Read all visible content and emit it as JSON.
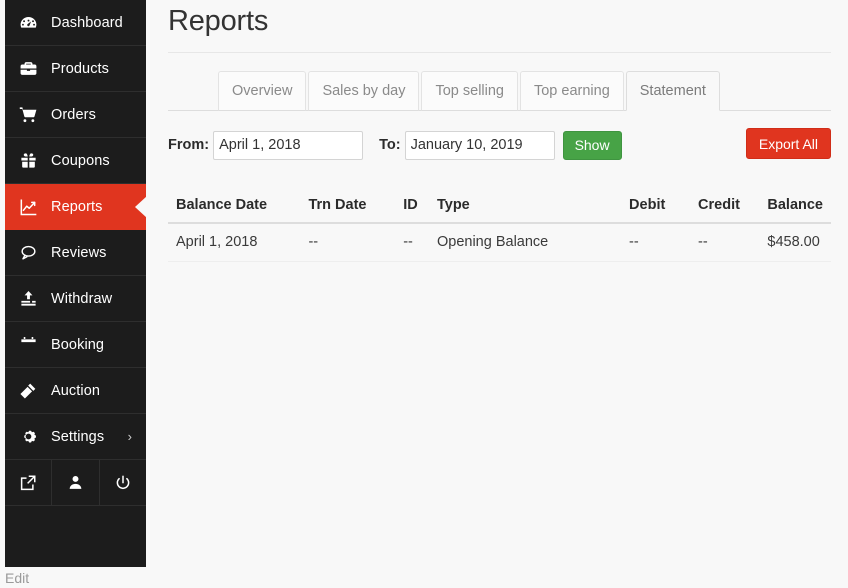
{
  "sidebar": {
    "items": [
      {
        "label": "Dashboard",
        "icon": "dashboard-gauge-icon",
        "active": false
      },
      {
        "label": "Products",
        "icon": "briefcase-icon",
        "active": false
      },
      {
        "label": "Orders",
        "icon": "shopping-cart-icon",
        "active": false
      },
      {
        "label": "Coupons",
        "icon": "gift-icon",
        "active": false
      },
      {
        "label": "Reports",
        "icon": "line-chart-icon",
        "active": true
      },
      {
        "label": "Reviews",
        "icon": "comment-icon",
        "active": false
      },
      {
        "label": "Withdraw",
        "icon": "upload-icon",
        "active": false
      },
      {
        "label": "Booking",
        "icon": "calendar-icon",
        "active": false
      },
      {
        "label": "Auction",
        "icon": "gavel-icon",
        "active": false
      },
      {
        "label": "Settings",
        "icon": "gear-icon",
        "active": false,
        "chevron": "›"
      }
    ],
    "footer_icons": [
      {
        "name": "external-link-icon"
      },
      {
        "name": "user-icon"
      },
      {
        "name": "power-icon"
      }
    ],
    "edit_link": "Edit",
    "active_color": "#e0351f",
    "background_color": "#1c1c1c"
  },
  "header": {
    "title": "Reports"
  },
  "tabs": [
    {
      "label": "Overview",
      "active": false
    },
    {
      "label": "Sales by day",
      "active": false
    },
    {
      "label": "Top selling",
      "active": false
    },
    {
      "label": "Top earning",
      "active": false
    },
    {
      "label": "Statement",
      "active": true
    }
  ],
  "filters": {
    "from_label": "From:",
    "from_value": "April 1, 2018",
    "from_placeholder": "From date",
    "to_label": "To:",
    "to_value": "January 10, 2019",
    "to_placeholder": "To date",
    "show_button": "Show",
    "export_button": "Export All",
    "show_button_color": "#47a346",
    "export_button_color": "#e0351f"
  },
  "table": {
    "columns": [
      "Balance Date",
      "Trn Date",
      "ID",
      "Type",
      "Debit",
      "Credit",
      "Balance"
    ],
    "rows": [
      {
        "balance_date": "April 1, 2018",
        "trn_date": "--",
        "id": "--",
        "type": "Opening Balance",
        "debit": "--",
        "credit": "--",
        "balance": "$458.00"
      }
    ]
  }
}
